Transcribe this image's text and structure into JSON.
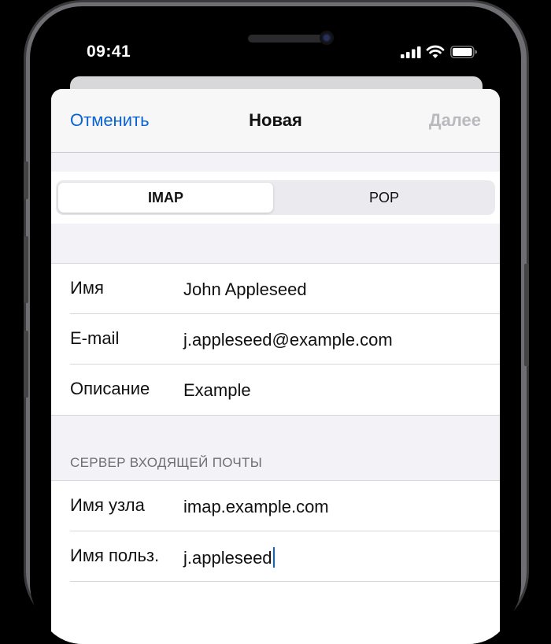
{
  "status_bar": {
    "time": "09:41",
    "icons": [
      "cellular-signal-icon",
      "wifi-icon",
      "battery-icon"
    ]
  },
  "nav": {
    "cancel": "Отменить",
    "title": "Новая",
    "next": "Далее"
  },
  "segmented": {
    "options": [
      "IMAP",
      "POP"
    ],
    "selected": "IMAP"
  },
  "account_fields": [
    {
      "label": "Имя",
      "value": "John Appleseed"
    },
    {
      "label": "E-mail",
      "value": "j.appleseed@example.com"
    },
    {
      "label": "Описание",
      "value": "Example"
    }
  ],
  "incoming_server": {
    "header": "СЕРВЕР ВХОДЯЩЕЙ ПОЧТЫ",
    "fields": [
      {
        "label": "Имя узла",
        "value": "imap.example.com"
      },
      {
        "label": "Имя польз.",
        "value": "j.appleseed"
      }
    ]
  },
  "colors": {
    "accent": "#0a64d2",
    "disabled": "#b9b9be",
    "background": "#f2f2f7"
  }
}
